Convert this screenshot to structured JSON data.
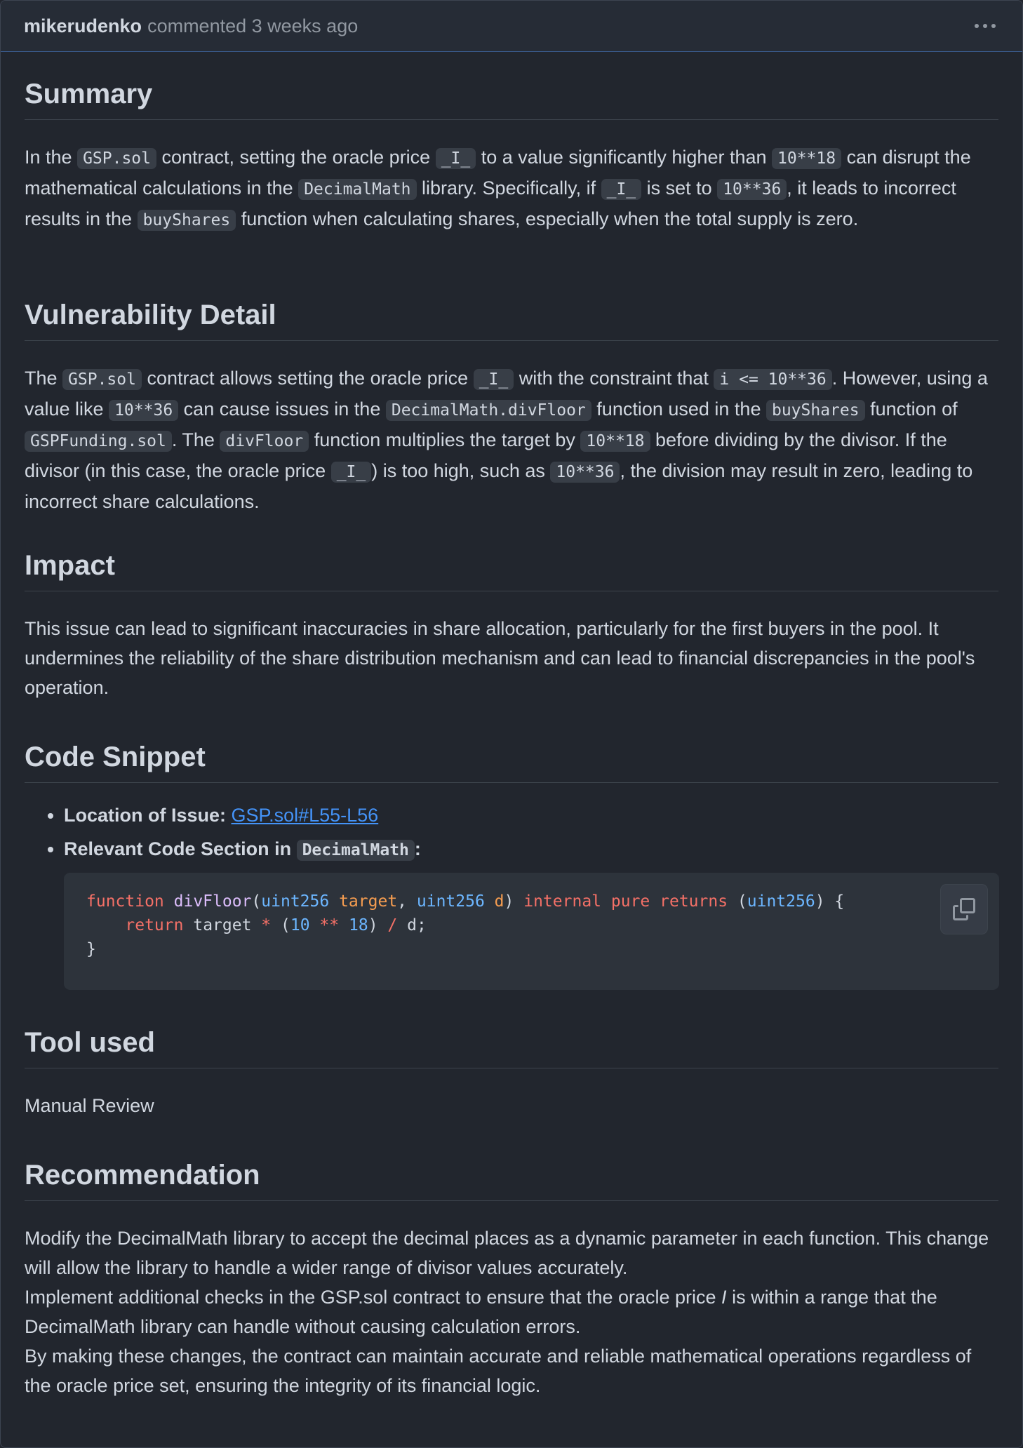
{
  "header": {
    "author": "mikerudenko",
    "meta": "commented 3 weeks ago"
  },
  "summary": {
    "heading": "Summary",
    "t1": "In the ",
    "c1": "GSP.sol",
    "t2": " contract, setting the oracle price ",
    "c2": "_I_",
    "t3": " to a value significantly higher than ",
    "c3": "10**18",
    "t4": " can disrupt the mathematical calculations in the ",
    "c4": "DecimalMath",
    "t5": " library. Specifically, if ",
    "c5": "_I_",
    "t6": " is set to ",
    "c6": "10**36",
    "t7": ", it leads to incorrect results in the ",
    "c7": "buyShares",
    "t8": " function when calculating shares, especially when the total supply is zero."
  },
  "vulnerability": {
    "heading": "Vulnerability Detail",
    "t1": "The ",
    "c1": "GSP.sol",
    "t2": " contract allows setting the oracle price ",
    "c2": "_I_",
    "t3": " with the constraint that ",
    "c3": "i <= 10**36",
    "t4": ". However, using a value like ",
    "c4": "10**36",
    "t5": " can cause issues in the ",
    "c5": "DecimalMath.divFloor",
    "t6": " function used in the ",
    "c6": "buyShares",
    "t7": " function of ",
    "c7": "GSPFunding.sol",
    "t8": ". The ",
    "c8": "divFloor",
    "t9": " function multiplies the target by ",
    "c9": "10**18",
    "t10": " before dividing by the divisor. If the divisor (in this case, the oracle price ",
    "c10": "_I_",
    "t11": ") is too high, such as ",
    "c11": "10**36",
    "t12": ", the division may result in zero, leading to incorrect share calculations."
  },
  "impact": {
    "heading": "Impact",
    "text": "This issue can lead to significant inaccuracies in share allocation, particularly for the first buyers in the pool. It undermines the reliability of the share distribution mechanism and can lead to financial discrepancies in the pool's operation."
  },
  "code_snippet": {
    "heading": "Code Snippet",
    "location_label": "Location of Issue: ",
    "location_link": "GSP.sol#L55-L56",
    "relevant_label": "Relevant Code Section in ",
    "relevant_code": "DecimalMath",
    "relevant_colon": ":",
    "code": {
      "kw_function": "function",
      "fn_name": "divFloor",
      "ty1": "uint256",
      "p1": "target",
      "ty2": "uint256",
      "p2": "d",
      "kw_internal": "internal",
      "kw_pure": "pure",
      "kw_returns": "returns",
      "ty3": "uint256",
      "kw_return": "return",
      "var_target": "target",
      "op_mul": "*",
      "n10": "10",
      "op_pow": "**",
      "n18": "18",
      "op_div": "/",
      "var_d": "d;"
    }
  },
  "tool_used": {
    "heading": "Tool used",
    "text": "Manual Review"
  },
  "recommendation": {
    "heading": "Recommendation",
    "line1": "Modify the DecimalMath library to accept the decimal places as a dynamic parameter in each function. This change will allow the library to handle a wider range of divisor values accurately.",
    "line2a": "Implement additional checks in the GSP.sol contract to ensure that the oracle price ",
    "line2i": "I",
    "line2b": " is within a range that the DecimalMath library can handle without causing calculation errors.",
    "line3": "By making these changes, the contract can maintain accurate and reliable mathematical operations regardless of the oracle price set, ensuring the integrity of its financial logic."
  },
  "icons": {
    "more": "kebab-horizontal-icon",
    "copy": "copy-icon"
  }
}
